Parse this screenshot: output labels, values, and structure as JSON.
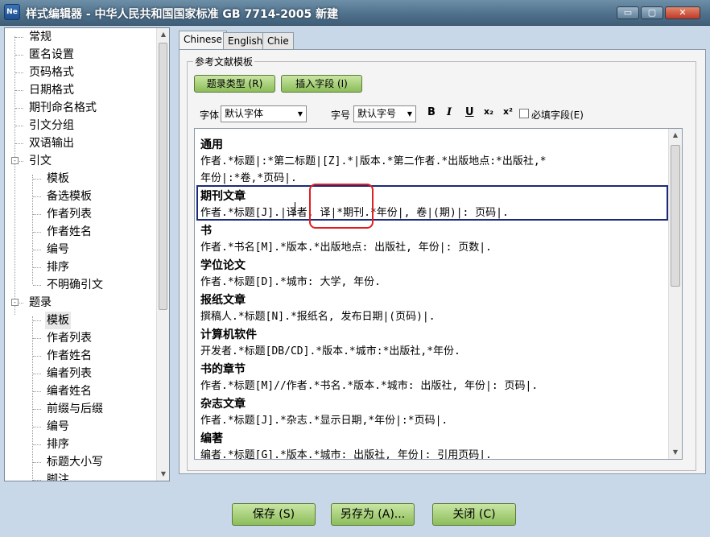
{
  "window": {
    "title": "样式编辑器 - 中华人民共和国国家标准 GB 7714-2005 新建",
    "app_icon": "Ne",
    "minimize": "▭",
    "maximize": "▢",
    "close": "✕"
  },
  "tree": {
    "items": [
      {
        "label": "常规"
      },
      {
        "label": "匿名设置"
      },
      {
        "label": "页码格式"
      },
      {
        "label": "日期格式"
      },
      {
        "label": "期刊命名格式"
      },
      {
        "label": "引文分组"
      },
      {
        "label": "双语输出"
      },
      {
        "label": "引文",
        "expander": "-"
      },
      {
        "label": "模板"
      },
      {
        "label": "备选模板"
      },
      {
        "label": "作者列表"
      },
      {
        "label": "作者姓名"
      },
      {
        "label": "编号"
      },
      {
        "label": "排序"
      },
      {
        "label": "不明确引文"
      },
      {
        "label": "题录",
        "expander": "-"
      },
      {
        "label": "模板",
        "selected": true
      },
      {
        "label": "作者列表"
      },
      {
        "label": "作者姓名"
      },
      {
        "label": "编者列表"
      },
      {
        "label": "编者姓名"
      },
      {
        "label": "前缀与后缀"
      },
      {
        "label": "编号"
      },
      {
        "label": "排序"
      },
      {
        "label": "标题大小写"
      },
      {
        "label": "脚注"
      }
    ]
  },
  "tabs": [
    {
      "label": "Chinese",
      "active": true
    },
    {
      "label": "English"
    },
    {
      "label": "Chie"
    }
  ],
  "group_label": "参考文献模板",
  "toolbar": {
    "ref_type_button": "题录类型 (R)",
    "insert_field_button": "插入字段 (I)",
    "font_label": "字体",
    "font_value": "默认字体",
    "size_label": "字号",
    "size_value": "默认字号",
    "bold": "B",
    "italic": "I",
    "underline": "U",
    "subscript": "x₂",
    "superscript": "x²",
    "required_label": "必填字段(E)"
  },
  "entries": [
    {
      "name": "通用",
      "lines": [
        "作者.*标题|:*第二标题|[Z].*|版本.*第二作者.*出版地点:*出版社,*",
        "年份|:*卷,*页码|."
      ]
    },
    {
      "name": "期刊文章",
      "lines": [
        "作者.*标题[J].|译者, 译|*期刊.*年份|, 卷|(期)|: 页码|."
      ]
    },
    {
      "name": "书",
      "lines": [
        "作者.*书名[M].*版本.*出版地点: 出版社, 年份|: 页数|."
      ]
    },
    {
      "name": "学位论文",
      "lines": [
        "作者.*标题[D].*城市: 大学, 年份."
      ]
    },
    {
      "name": "报纸文章",
      "lines": [
        "撰稿人.*标题[N].*报纸名, 发布日期|(页码)|."
      ]
    },
    {
      "name": "计算机软件",
      "lines": [
        "开发者.*标题[DB/CD].*版本.*城市:*出版社,*年份."
      ]
    },
    {
      "name": "书的章节",
      "lines": [
        "作者.*标题[M]//作者.*书名.*版本.*城市: 出版社, 年份|: 页码|."
      ]
    },
    {
      "name": "杂志文章",
      "lines": [
        "作者.*标题[J].*杂志.*显示日期,*年份|:*页码|."
      ]
    },
    {
      "name": "编著",
      "lines": [
        "编者.*标题[G].*版本.*城市: 出版社, 年份|: 引用页码|."
      ]
    }
  ],
  "buttons": {
    "save": "保存 (S)",
    "save_as": "另存为 (A)...",
    "close": "关闭 (C)"
  }
}
